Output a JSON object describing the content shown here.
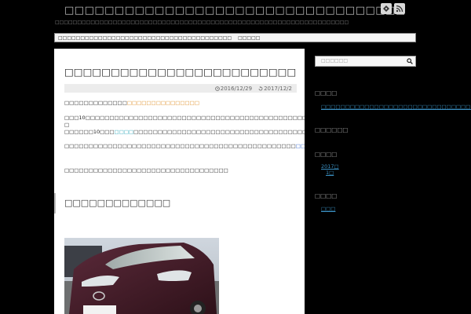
{
  "header": {
    "site_title": "□□□□□□□□□□□□□□□□□□□□□□□□□□□□□□□□□□",
    "description": "□□□□□□□□□□□□□□□□□□□□□□□□□□□□□□□□□□□□□□□□□□□□□□□□□□□□□□□□□□□□□□□□□□",
    "icons": [
      "feedly-icon",
      "rss-icon"
    ]
  },
  "nav": {
    "items": [
      "□□□□□□□□□□□□□□□□□□□□□□□□□□□□□□□□□□□□□□□",
      "□□□□□"
    ]
  },
  "post": {
    "title": "□□□□□□□□□□□□□□□□□□□□□□□□□□□□□□□□□□□□□□□",
    "published": "2016/12/29",
    "updated": "2017/12/2",
    "p1_text": "□□□□□□□□□□□□□",
    "p1_link": "□□□□□□□□□□□□□□□",
    "p2": "□□□10□□□□□□□□□□□□□□□□□□□□□□□□□□□□□□□□□□□□□□□□□□□□□□□□□□□□□□□□□□□□□□□□□□□□□□□□…□",
    "p3_a": "□□□□□□10□□□",
    "p3_link": "□□□□",
    "p3_b": "□□□□□□□□□□□□□□□□□□□□□□□□□□□□□□□□□□□□□□□□□□□□□□□□□□□□□□",
    "p4_a": "□□□□□□□□□□□□□□□□□□□□□□□□□□□□□□□□□□□□□□□□□□□□□□□□",
    "p4_link": "□□□□□□□□□□□□□□□□□□□□□□□□□□□□□□□□□□□□□□□□□□□□□□□□□□□□□□□",
    "p4_end": "□",
    "p5": "□□□□□□□□□□□□□□□□□□□□□□□□□□□□□□□□□□",
    "section_heading": "□□□□□□□□□□□□□"
  },
  "sidebar": {
    "search_placeholder": "□□□□□□",
    "recent_heading": "□□□□",
    "recent_post": "□□□□□□□□□□□□□□□□□□□□□□□□□□□□□□□□□□□□",
    "comments_heading": "□□□□□□",
    "archives_heading": "□□□□",
    "archive_item_a": "2017□",
    "archive_item_b": "1□",
    "categories_heading": "□□□□",
    "category_item": "□□□"
  },
  "colors": {
    "link": "#3366cc",
    "accent": "#e0902a",
    "sidebar_link": "#3a8fc1"
  }
}
